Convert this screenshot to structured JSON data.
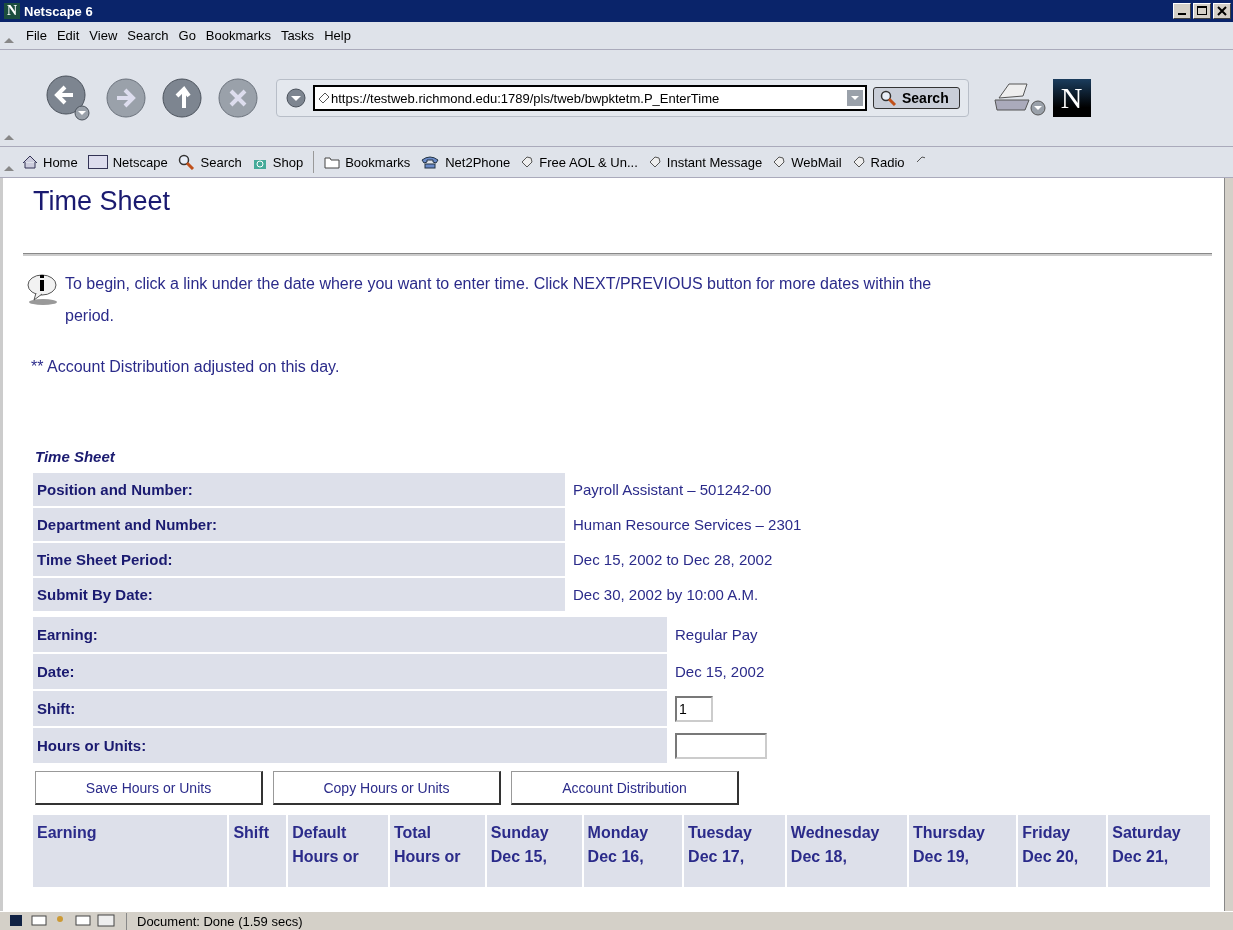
{
  "window": {
    "title": "Netscape 6",
    "logo": "N"
  },
  "menu": [
    "File",
    "Edit",
    "View",
    "Search",
    "Go",
    "Bookmarks",
    "Tasks",
    "Help"
  ],
  "navigation": {
    "url": "https://testweb.richmond.edu:1789/pls/tweb/bwpktetm.P_EnterTime",
    "search_button": "Search",
    "logo": "N"
  },
  "personal_toolbar": [
    {
      "label": "Home",
      "kind": "home"
    },
    {
      "label": "Netscape",
      "kind": "my"
    },
    {
      "label": "Search",
      "kind": "search"
    },
    {
      "label": "Shop",
      "kind": "shop"
    },
    {
      "label": "Bookmarks",
      "kind": "folder"
    },
    {
      "label": "Net2Phone",
      "kind": "phone"
    },
    {
      "label": "Free AOL & Un...",
      "kind": "link"
    },
    {
      "label": "Instant Message",
      "kind": "link"
    },
    {
      "label": "WebMail",
      "kind": "link"
    },
    {
      "label": "Radio",
      "kind": "link"
    }
  ],
  "page": {
    "heading": "Time Sheet",
    "info": "To begin, click a link under the date where you want to enter time. Click NEXT/PREVIOUS button for more dates within the period.",
    "note": "** Account Distribution adjusted on this day.",
    "section_title": "Time Sheet",
    "details": [
      {
        "label": "Position and Number:",
        "value": "Payroll Assistant – 501242-00"
      },
      {
        "label": "Department and Number:",
        "value": "Human Resource Services – 2301"
      },
      {
        "label": "Time Sheet Period:",
        "value": "Dec 15, 2002 to Dec 28, 2002"
      },
      {
        "label": "Submit By Date:",
        "value": "Dec 30, 2002 by 10:00 A.M."
      }
    ],
    "entry": [
      {
        "label": "Earning:",
        "kind": "text",
        "value": "Regular Pay"
      },
      {
        "label": "Date:",
        "kind": "text",
        "value": "Dec 15, 2002"
      },
      {
        "label": "Shift:",
        "kind": "input",
        "value": "1"
      },
      {
        "label": "Hours or Units:",
        "kind": "input"
      }
    ],
    "buttons": [
      "Save Hours or Units",
      "Copy Hours or Units",
      "Account Distribution"
    ],
    "table": {
      "columns": [
        [
          "Earning"
        ],
        [
          "Shift"
        ],
        [
          "Default",
          "Hours or"
        ],
        [
          "Total",
          "Hours or"
        ],
        [
          "Sunday",
          "Dec 15,"
        ],
        [
          "Monday",
          "Dec 16,"
        ],
        [
          "Tuesday",
          "Dec 17,"
        ],
        [
          "Wednesday",
          "Dec 18,"
        ],
        [
          "Thursday",
          "Dec 19,"
        ],
        [
          "Friday",
          "Dec 20,"
        ],
        [
          "Saturday",
          "Dec 21,"
        ]
      ]
    }
  },
  "status_bar": {
    "text": "Document: Done (1.59 secs)"
  }
}
